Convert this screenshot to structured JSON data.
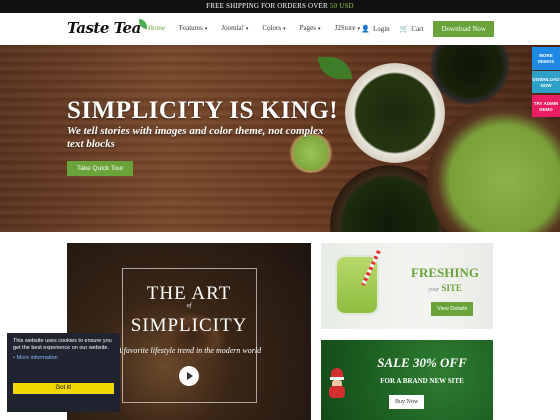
{
  "topbar": {
    "text_prefix": "FREE SHIPPING FOR ORDERS OVER",
    "text_amount": "50 USD"
  },
  "brand": {
    "logo": "Taste Tea"
  },
  "nav": {
    "items": [
      {
        "label": "Home"
      },
      {
        "label": "Features"
      },
      {
        "label": "Joomla!"
      },
      {
        "label": "Colors"
      },
      {
        "label": "Pages"
      },
      {
        "label": "J2Store"
      }
    ]
  },
  "header": {
    "login": "Login",
    "cart": "Cart",
    "download": "Download Now"
  },
  "hero": {
    "title": "SIMPLICITY IS KING!",
    "subtitle": "We tell stories with images and color theme, not complex text blocks",
    "cta": "Take Quick Tour"
  },
  "side_buttons": [
    {
      "label": "MORE DEMOS"
    },
    {
      "label": "DOWNLOAD NOW"
    },
    {
      "label": "TRY ADMIN DEMO"
    }
  ],
  "art_card": {
    "line1": "THE ART",
    "of": "of",
    "line2": "SIMPLICITY",
    "tagline": "A favorite lifestyle trend in the modern world"
  },
  "fresh_card": {
    "title": "FRESHING",
    "sub_small": "your",
    "sub": "SITE",
    "button": "View Details"
  },
  "sale_card": {
    "title": "SALE 30% OFF",
    "sub": "FOR A BRAND NEW SITE",
    "button": "Buy Now"
  },
  "cookie": {
    "message": "This website uses cookies to ensure you get the best experience on our website.",
    "more": "More information",
    "ok": "Got it!"
  },
  "colors": {
    "accent": "#6aa33a",
    "topbar": "#111111",
    "cookie_bg": "#1f2430",
    "cookie_btn": "#f1d600"
  }
}
